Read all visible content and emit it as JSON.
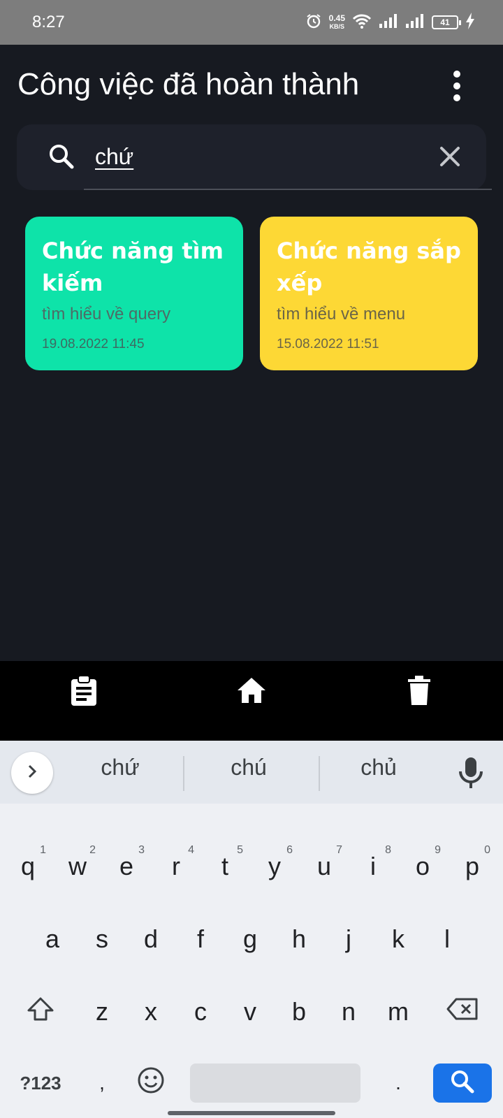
{
  "status_bar": {
    "time": "8:27",
    "net_speed_value": "0.45",
    "net_speed_unit": "KB/S",
    "battery": "41"
  },
  "header": {
    "title": "Công việc đã hoàn thành"
  },
  "search": {
    "value": "chứ"
  },
  "cards": [
    {
      "title": "Chức năng tìm kiếm",
      "description": "tìm hiểu về query",
      "date": "19.08.2022 11:45",
      "color": "#0ee3a9"
    },
    {
      "title": "Chức năng sắp xếp",
      "description": "tìm hiểu về menu",
      "date": "15.08.2022 11:51",
      "color": "#fdd835"
    }
  ],
  "bottom_nav": {
    "icons": [
      "clipboard-icon",
      "home-icon",
      "trash-icon"
    ]
  },
  "keyboard": {
    "suggestions": [
      "chứ",
      "chú",
      "chủ"
    ],
    "row1": [
      "q",
      "w",
      "e",
      "r",
      "t",
      "y",
      "u",
      "i",
      "o",
      "p"
    ],
    "row1_hints": [
      "1",
      "2",
      "3",
      "4",
      "5",
      "6",
      "7",
      "8",
      "9",
      "0"
    ],
    "row2": [
      "a",
      "s",
      "d",
      "f",
      "g",
      "h",
      "j",
      "k",
      "l"
    ],
    "row3": [
      "z",
      "x",
      "c",
      "v",
      "b",
      "n",
      "m"
    ],
    "symbols_label": "?123",
    "comma": ",",
    "period": "."
  }
}
